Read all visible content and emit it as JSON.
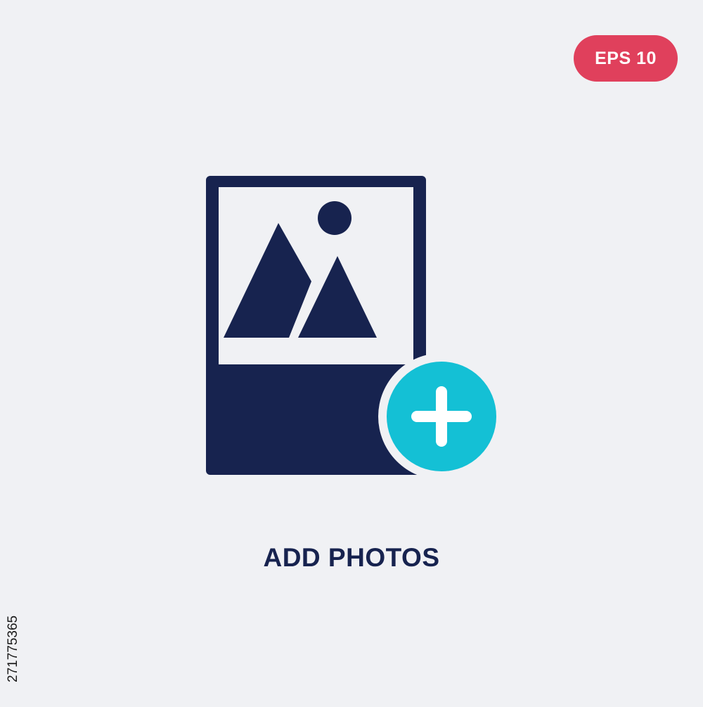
{
  "badge": {
    "label": "EPS 10",
    "color": "#e0405c"
  },
  "icon": {
    "name": "add-photos-icon",
    "primary_color": "#17234f",
    "accent_color": "#14c0d5"
  },
  "caption": {
    "text": "ADD PHOTOS",
    "color": "#17234f"
  },
  "stock_id": "271775365"
}
